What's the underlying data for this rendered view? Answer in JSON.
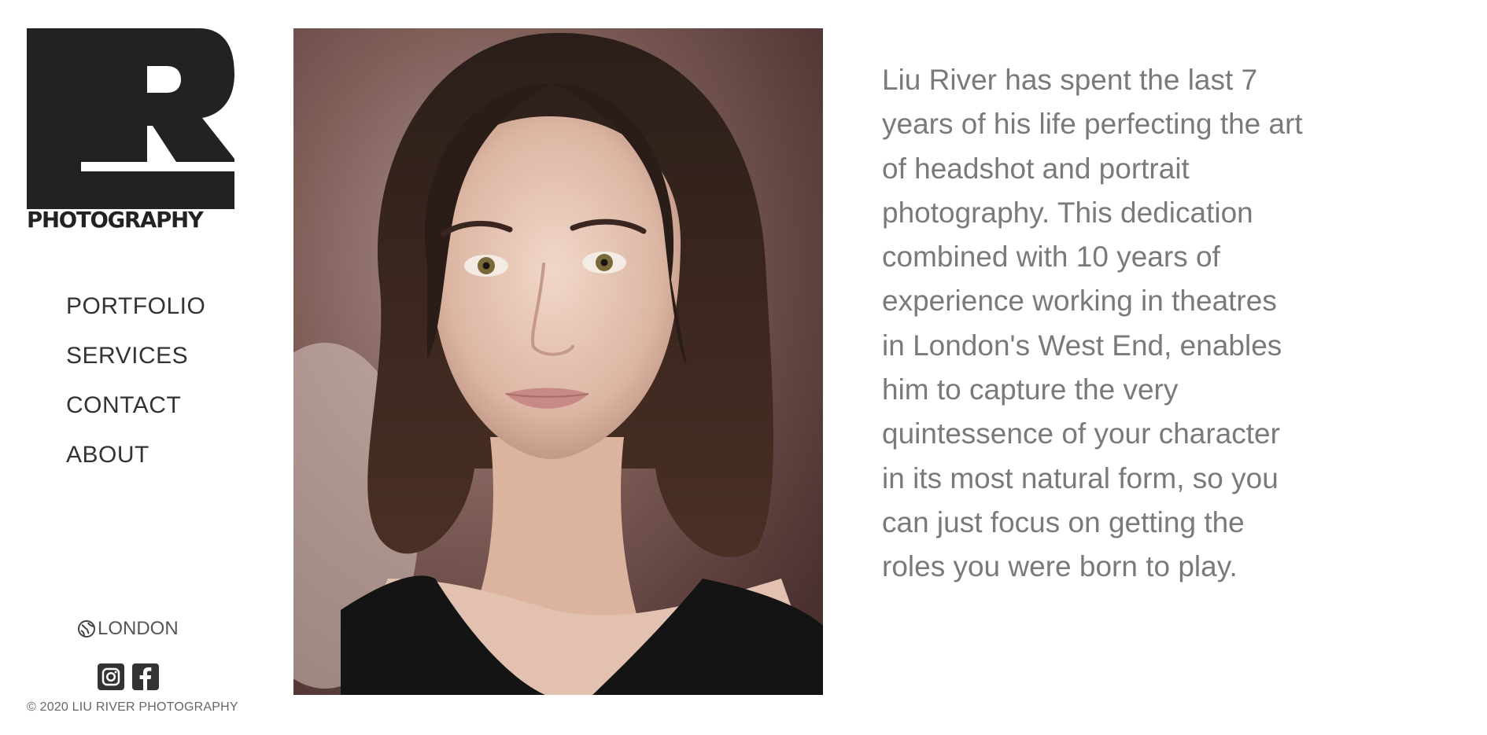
{
  "brand": {
    "logo_letters": "LR",
    "logo_subtitle": "PHOTOGRAPHY",
    "logo_color": "#222222"
  },
  "nav": {
    "items": [
      {
        "label": "PORTFOLIO"
      },
      {
        "label": "SERVICES"
      },
      {
        "label": "CONTACT"
      },
      {
        "label": "ABOUT"
      }
    ]
  },
  "footer": {
    "location": "LONDON",
    "location_icon": "globe-icon",
    "social": [
      {
        "name": "instagram-icon"
      },
      {
        "name": "facebook-icon"
      }
    ],
    "copyright": "© 2020 LIU RIVER PHOTOGRAPHY"
  },
  "hero": {
    "image_subject": "headshot-portrait"
  },
  "bio": {
    "text": "Liu River has spent the last 7 years of his life perfecting the art of headshot and portrait photography. This dedication combined with 10 years of experience working in theatres in London's West End, enables him to capture the very quintessence of your character in its most natural form, so you can just focus on getting the roles you were born to play."
  },
  "colors": {
    "text_dark": "#333333",
    "text_muted": "#7a7a7a",
    "background": "#ffffff"
  }
}
